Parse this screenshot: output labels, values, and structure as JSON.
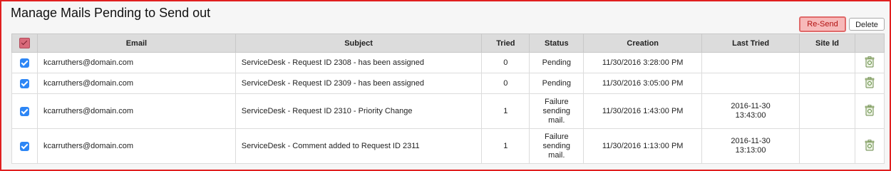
{
  "page": {
    "title": "Manage Mails Pending to Send out"
  },
  "toolbar": {
    "resend_label": "Re-Send",
    "delete_label": "Delete"
  },
  "table": {
    "headers": {
      "email": "Email",
      "subject": "Subject",
      "tried": "Tried",
      "status": "Status",
      "creation": "Creation",
      "last_tried": "Last Tried",
      "site_id": "Site Id"
    },
    "rows": [
      {
        "email": "kcarruthers@domain.com",
        "subject": "ServiceDesk - Request ID 2308 - has been assigned",
        "tried": "0",
        "status": "Pending",
        "creation": "11/30/2016 3:28:00 PM",
        "last_tried": "",
        "site_id": ""
      },
      {
        "email": "kcarruthers@domain.com",
        "subject": "ServiceDesk - Request ID 2309 - has been assigned",
        "tried": "0",
        "status": "Pending",
        "creation": "11/30/2016 3:05:00 PM",
        "last_tried": "",
        "site_id": ""
      },
      {
        "email": "kcarruthers@domain.com",
        "subject": "ServiceDesk - Request ID 2310 - Priority Change",
        "tried": "1",
        "status": "Failure sending mail.",
        "creation": "11/30/2016 1:43:00 PM",
        "last_tried": "2016-11-30 13:43:00",
        "site_id": ""
      },
      {
        "email": "kcarruthers@domain.com",
        "subject": "ServiceDesk - Comment added to Request ID 2311",
        "tried": "1",
        "status": "Failure sending mail.",
        "creation": "11/30/2016 1:13:00 PM",
        "last_tried": "2016-11-30 13:13:00",
        "site_id": ""
      }
    ]
  },
  "icons": {
    "row_action": "trash-icon",
    "row_check": "checkbox-checked-icon"
  },
  "colors": {
    "accent_red": "#e02020",
    "checkbox_blue": "#2d86f5",
    "resend_bg": "#f7b9b9"
  }
}
